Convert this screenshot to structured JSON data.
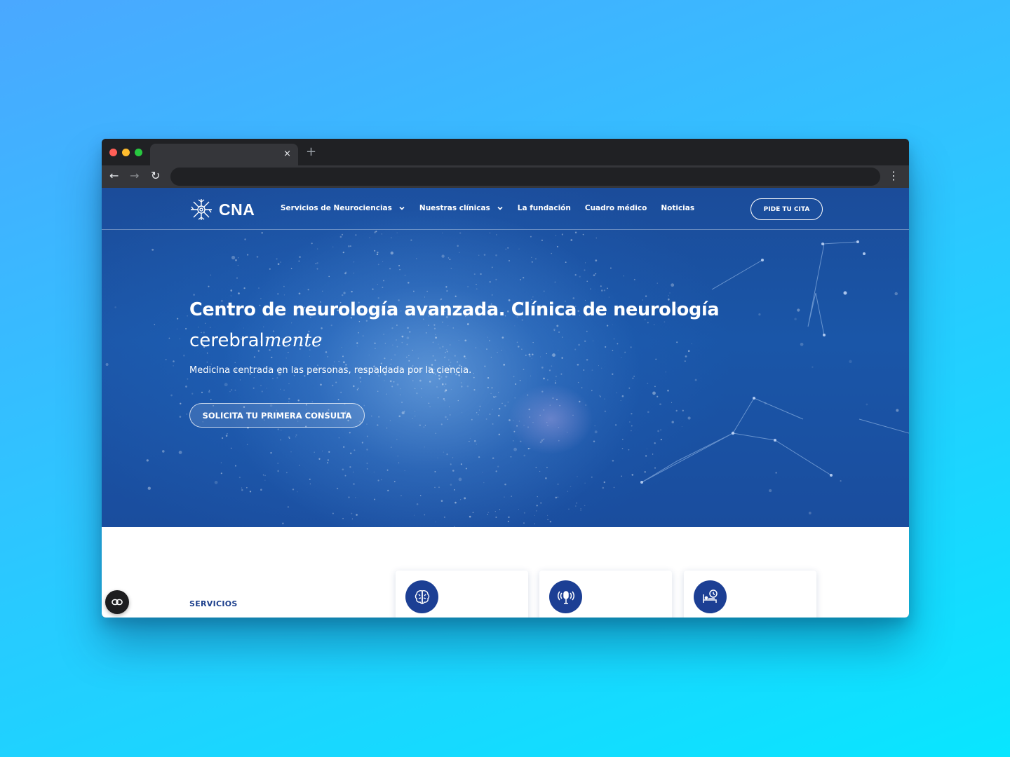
{
  "browser": {
    "tab_close": "×",
    "new_tab": "+",
    "back": "←",
    "forward": "→",
    "reload": "↻",
    "menu": "⋮"
  },
  "header": {
    "logo_text": "CNA",
    "nav": [
      {
        "label": "Servicios de Neurociencias",
        "dropdown": true
      },
      {
        "label": "Nuestras clínicas",
        "dropdown": true
      },
      {
        "label": "La fundación",
        "dropdown": false
      },
      {
        "label": "Cuadro médico",
        "dropdown": false
      },
      {
        "label": "Noticias",
        "dropdown": false
      }
    ],
    "cta": "PIDE TU CITA"
  },
  "hero": {
    "title_line1": "Centro de neurología avanzada. Clínica de neurología",
    "title_line2_plain": "cerebral",
    "title_line2_italic": "mente",
    "subtitle": "Medicina centrada en las personas, respaldada por la ciencia.",
    "cta": "SOLICITA TU PRIMERA CONSULTA"
  },
  "services": {
    "label": "SERVICIOS",
    "cards": [
      {
        "icon": "brain-icon"
      },
      {
        "icon": "microphone-icon"
      },
      {
        "icon": "hospital-bed-clock-icon"
      }
    ]
  },
  "floating_button": {
    "icon": "link-icon"
  },
  "colors": {
    "brand_blue": "#1c3f94",
    "hero_blue": "#1a56a8",
    "background_start": "#4aa8ff",
    "background_end": "#08e6ff"
  }
}
